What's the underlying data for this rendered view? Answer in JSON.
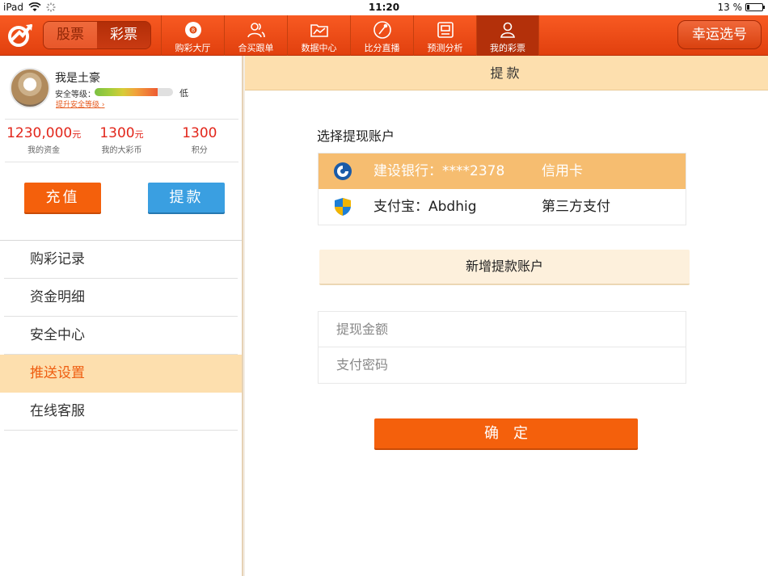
{
  "status_bar": {
    "device": "iPad",
    "time": "11:20",
    "battery": "13 %",
    "battery_level": 0.13
  },
  "top_nav": {
    "segments": [
      {
        "label": "股票",
        "active": false
      },
      {
        "label": "彩票",
        "active": true
      }
    ],
    "tabs": [
      {
        "label": "购彩大厅",
        "icon": "lottery-ball-icon",
        "active": false
      },
      {
        "label": "合买跟单",
        "icon": "users-icon",
        "active": false
      },
      {
        "label": "数据中心",
        "icon": "folder-chart-icon",
        "active": false
      },
      {
        "label": "比分直播",
        "icon": "live-score-icon",
        "active": false
      },
      {
        "label": "预测分析",
        "icon": "document-icon",
        "active": false
      },
      {
        "label": "我的彩票",
        "icon": "user-icon",
        "active": true
      }
    ],
    "lucky_button": "幸运选号"
  },
  "sidebar": {
    "user": {
      "name": "我是土豪",
      "security_label": "安全等级：",
      "security_level": "低",
      "security_progress": 0.8,
      "upgrade_link": "提升安全等级"
    },
    "stats": [
      {
        "value": "1230,000",
        "unit": "元",
        "caption": "我的资金"
      },
      {
        "value": "1300",
        "unit": "元",
        "caption": "我的大彩币"
      },
      {
        "value": "1300",
        "unit": "",
        "caption": "积分"
      }
    ],
    "recharge_button": "充值",
    "withdraw_button": "提款",
    "menu": [
      {
        "label": "购彩记录",
        "active": false
      },
      {
        "label": "资金明细",
        "active": false
      },
      {
        "label": "安全中心",
        "active": false
      },
      {
        "label": "推送设置",
        "active": true
      },
      {
        "label": "在线客服",
        "active": false
      }
    ]
  },
  "main": {
    "header": "提款",
    "select_account_title": "选择提现账户",
    "accounts": [
      {
        "name": "建设银行：****2378",
        "type": "信用卡",
        "icon": "ccb-bank-icon",
        "selected": true
      },
      {
        "name": "支付宝：Abdhig",
        "type": "第三方支付",
        "icon": "alipay-shield-icon",
        "selected": false
      }
    ],
    "add_account_button": "新增提款账户",
    "amount_field": {
      "placeholder": "提现金额",
      "value": ""
    },
    "password_field": {
      "placeholder": "支付密码",
      "value": ""
    },
    "confirm_button": "确定"
  },
  "colors": {
    "brand_orange": "#f4600c",
    "blue_button": "#3a9fe1",
    "highlight": "#fddfae",
    "selected_account": "#f6bd70",
    "money_red": "#e2261b"
  }
}
